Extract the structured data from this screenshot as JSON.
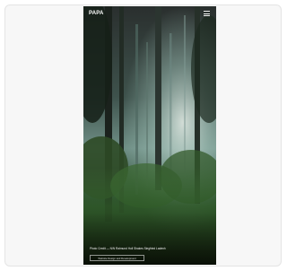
{
  "header": {
    "logo_text": "PAPA",
    "menu_icon": "hamburger-menu-icon"
  },
  "hero": {
    "image_subject": "misty forest photograph",
    "caption": "Photo Credit — N/N Raimund Holl Shakes Siegfried Ladenh",
    "button_label": "Website Design and Development"
  },
  "colors": {
    "card_background": "#f7f7f7",
    "card_border": "#e4e4e4",
    "forest_dark": "#1d2a1f",
    "mist": "#a9c9c0"
  }
}
